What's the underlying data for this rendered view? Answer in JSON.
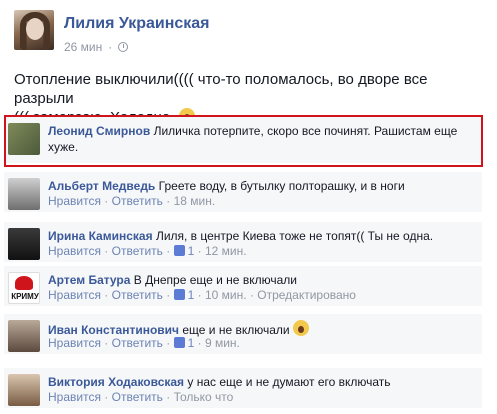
{
  "post": {
    "author": "Лилия Украинская",
    "time": "26 мин",
    "text_line1": "Отопление выключили(((( что-то поломалось, во дворе все разрыли",
    "text_line2": "((( замерзаю. Холодно."
  },
  "actions": {
    "like": "Нравится",
    "reply": "Ответить",
    "edited": "Отредактировано"
  },
  "comments": [
    {
      "name": "Леонид Смирнов",
      "text_a": "Лиличка потерпите, скоро все починят. Рашистам еще",
      "text_b": "хуже."
    },
    {
      "name": "Альберт Медведь",
      "text": "Греете воду, в бутылку полторашку, и в ноги",
      "time": "18 мин."
    },
    {
      "name": "Ирина Каминская",
      "text": "Лиля, в центре Киева тоже не топят(( Ты не одна.",
      "likes": "1",
      "time": "12 мин."
    },
    {
      "name": "Артем Батура",
      "text": "В Днепре еще и не включали",
      "likes": "1",
      "time": "10 мин.",
      "avatar_text": "КРИМУ"
    },
    {
      "name": "Иван Константинович",
      "text": "еще и не включали",
      "likes": "1",
      "time": "9 мин."
    },
    {
      "name": "Виктория Ходаковская",
      "text": "у нас еще и не думают его включать",
      "time": "Только что"
    }
  ],
  "colors": {
    "link": "#3b5998",
    "meta": "#9197a3",
    "highlight": "#d0141c",
    "comment_bg": "#f6f7f9"
  }
}
